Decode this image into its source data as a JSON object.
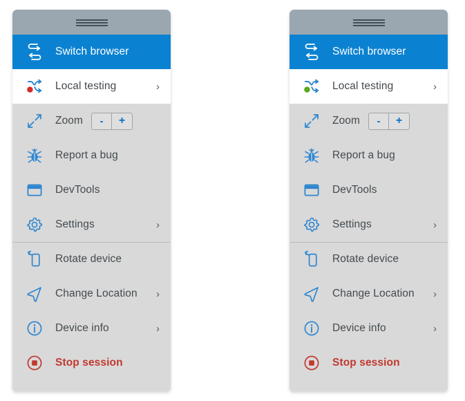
{
  "theme": {
    "titlebar_color": "#9aa7b1",
    "panel_bg": "#d9d9d9",
    "accent_blue": "#0b82d1",
    "icon_blue": "#2f86cf",
    "danger_red": "#c0392f",
    "status_red": "#d62b23",
    "status_green": "#5aa81e",
    "text_color": "#444a4f"
  },
  "panels": [
    {
      "id": "panel-local-testing-off",
      "grip": {
        "name": "drag-handle-icon",
        "lines": 3
      },
      "items": [
        {
          "key": "switch-browser",
          "label": "Switch browser",
          "icon": "switch-browser-icon",
          "state": "selected",
          "chevron": "",
          "control": "none"
        },
        {
          "key": "local-testing",
          "label": "Local testing",
          "icon": "local-testing-icon",
          "state": "light",
          "chevron": "›",
          "status_dot": "#d62b23",
          "control": "none"
        },
        {
          "key": "zoom",
          "label": "Zoom",
          "icon": "zoom-expand-icon",
          "state": "normal",
          "chevron": "",
          "control": "stepper",
          "stepper": {
            "minus": "-",
            "plus": "+"
          }
        },
        {
          "key": "report-a-bug",
          "label": "Report a bug",
          "icon": "bug-icon",
          "state": "normal",
          "chevron": "",
          "control": "none"
        },
        {
          "key": "devtools",
          "label": "DevTools",
          "icon": "devtools-window-icon",
          "state": "normal",
          "chevron": "",
          "control": "none"
        },
        {
          "key": "settings",
          "label": "Settings",
          "icon": "gear-icon",
          "state": "normal",
          "chevron": "›",
          "control": "none"
        },
        {
          "key": "rotate-device",
          "label": "Rotate device",
          "icon": "rotate-device-icon",
          "state": "normal",
          "separator_above": true,
          "chevron": "",
          "control": "none"
        },
        {
          "key": "change-location",
          "label": "Change Location",
          "icon": "location-arrow-icon",
          "state": "normal",
          "chevron": "›",
          "control": "none"
        },
        {
          "key": "device-info",
          "label": "Device info",
          "icon": "info-circle-icon",
          "state": "normal",
          "chevron": "›",
          "control": "none"
        },
        {
          "key": "stop-session",
          "label": "Stop session",
          "icon": "stop-session-icon",
          "state": "danger",
          "chevron": "",
          "control": "none"
        }
      ]
    },
    {
      "id": "panel-local-testing-on",
      "grip": {
        "name": "drag-handle-icon",
        "lines": 3
      },
      "items": [
        {
          "key": "switch-browser",
          "label": "Switch browser",
          "icon": "switch-browser-icon",
          "state": "selected",
          "chevron": "",
          "control": "none"
        },
        {
          "key": "local-testing",
          "label": "Local testing",
          "icon": "local-testing-icon",
          "state": "light",
          "chevron": "›",
          "status_dot": "#5aa81e",
          "control": "none"
        },
        {
          "key": "zoom",
          "label": "Zoom",
          "icon": "zoom-expand-icon",
          "state": "normal",
          "chevron": "",
          "control": "stepper",
          "stepper": {
            "minus": "-",
            "plus": "+"
          }
        },
        {
          "key": "report-a-bug",
          "label": "Report a bug",
          "icon": "bug-icon",
          "state": "normal",
          "chevron": "",
          "control": "none"
        },
        {
          "key": "devtools",
          "label": "DevTools",
          "icon": "devtools-window-icon",
          "state": "normal",
          "chevron": "",
          "control": "none"
        },
        {
          "key": "settings",
          "label": "Settings",
          "icon": "gear-icon",
          "state": "normal",
          "chevron": "›",
          "control": "none"
        },
        {
          "key": "rotate-device",
          "label": "Rotate device",
          "icon": "rotate-device-icon",
          "state": "normal",
          "separator_above": true,
          "chevron": "",
          "control": "none"
        },
        {
          "key": "change-location",
          "label": "Change Location",
          "icon": "location-arrow-icon",
          "state": "normal",
          "chevron": "›",
          "control": "none"
        },
        {
          "key": "device-info",
          "label": "Device info",
          "icon": "info-circle-icon",
          "state": "normal",
          "chevron": "›",
          "control": "none"
        },
        {
          "key": "stop-session",
          "label": "Stop session",
          "icon": "stop-session-icon",
          "state": "danger",
          "chevron": "",
          "control": "none"
        }
      ]
    }
  ]
}
